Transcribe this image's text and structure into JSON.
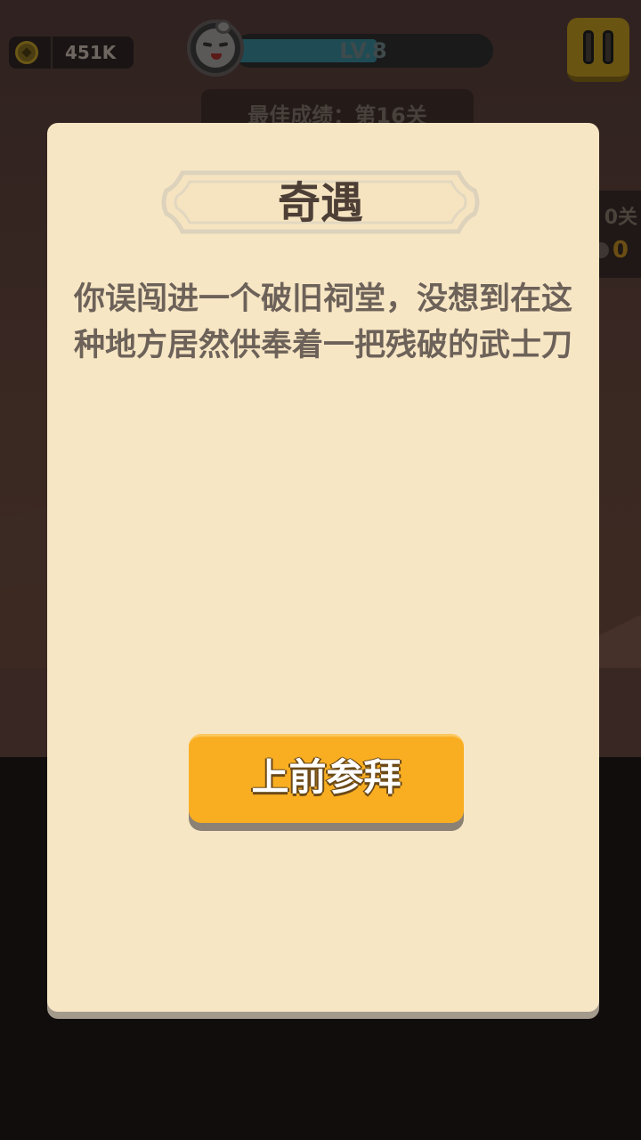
{
  "hud": {
    "coins": "451K",
    "level": "LV.8",
    "level_progress": 0.55,
    "best_score": "最佳成绩：第16关",
    "side_stage": "0关",
    "side_count": "0"
  },
  "dialog": {
    "title": "奇遇",
    "story": "你误闯进一个破旧祠堂，没想到在这种地方居然供奉着一把残破的武士刀",
    "button_label": "上前参拜"
  },
  "colors": {
    "panel": "#f7e6c4",
    "button": "#f9ae22",
    "title_text": "#4d3f36",
    "story_text": "#6d6259"
  }
}
